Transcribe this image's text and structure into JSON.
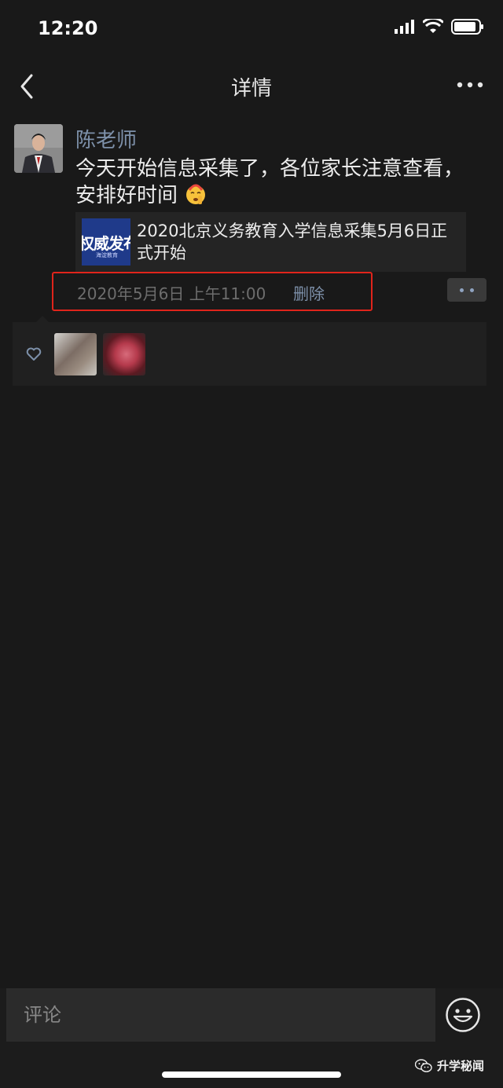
{
  "status_bar": {
    "time": "12:20"
  },
  "nav": {
    "title": "详情"
  },
  "post": {
    "author": "陈老师",
    "text": "今天开始信息采集了，各位家长注意查看，安排好时间",
    "emoji": "shushing-face-emoji",
    "link": {
      "thumb_text": "权威发布",
      "thumb_subtext": "海淀教育",
      "title": "2020北京义务教育入学信息采集5月6日正式开始"
    },
    "timestamp": "2020年5月6日 上午11:00",
    "delete_label": "删除"
  },
  "likes": {
    "count": 2
  },
  "comment": {
    "placeholder": "评论"
  },
  "watermark": {
    "text": "升学秘闻"
  },
  "colors": {
    "background": "#191919",
    "author_blue": "#7d90a9",
    "highlight_red": "#e0241b",
    "card_bg": "#242424"
  }
}
